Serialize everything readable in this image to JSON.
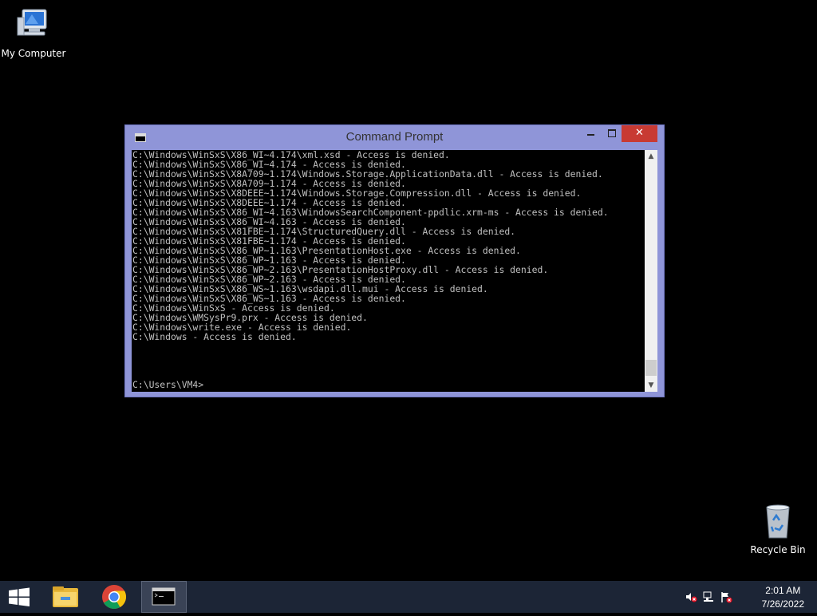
{
  "desktop": {
    "icons": [
      {
        "label": "My Computer"
      },
      {
        "label": "Recycle Bin"
      }
    ]
  },
  "window": {
    "title": "Command Prompt",
    "console_lines": [
      "C:\\Windows\\WinSxS\\X86_WI~4.174\\xml.xsd - Access is denied.",
      "C:\\Windows\\WinSxS\\X86_WI~4.174 - Access is denied.",
      "C:\\Windows\\WinSxS\\X8A709~1.174\\Windows.Storage.ApplicationData.dll - Access is denied.",
      "C:\\Windows\\WinSxS\\X8A709~1.174 - Access is denied.",
      "C:\\Windows\\WinSxS\\X8DEEE~1.174\\Windows.Storage.Compression.dll - Access is denied.",
      "C:\\Windows\\WinSxS\\X8DEEE~1.174 - Access is denied.",
      "C:\\Windows\\WinSxS\\X86_WI~4.163\\WindowsSearchComponent-ppdlic.xrm-ms - Access is denied.",
      "C:\\Windows\\WinSxS\\X86_WI~4.163 - Access is denied.",
      "C:\\Windows\\WinSxS\\X81FBE~1.174\\StructuredQuery.dll - Access is denied.",
      "C:\\Windows\\WinSxS\\X81FBE~1.174 - Access is denied.",
      "C:\\Windows\\WinSxS\\X86_WP~1.163\\PresentationHost.exe - Access is denied.",
      "C:\\Windows\\WinSxS\\X86_WP~1.163 - Access is denied.",
      "C:\\Windows\\WinSxS\\X86_WP~2.163\\PresentationHostProxy.dll - Access is denied.",
      "C:\\Windows\\WinSxS\\X86_WP~2.163 - Access is denied.",
      "C:\\Windows\\WinSxS\\X86_WS~1.163\\wsdapi.dll.mui - Access is denied.",
      "C:\\Windows\\WinSxS\\X86_WS~1.163 - Access is denied.",
      "C:\\Windows\\WinSxS - Access is denied.",
      "C:\\Windows\\WMSysPr9.prx - Access is denied.",
      "C:\\Windows\\write.exe - Access is denied.",
      "C:\\Windows - Access is denied."
    ],
    "prompt": "C:\\Users\\VM4>"
  },
  "taskbar": {
    "apps": [
      {
        "icon": "start-windows-icon"
      },
      {
        "icon": "file-explorer-icon"
      },
      {
        "icon": "chrome-icon"
      },
      {
        "icon": "command-prompt-icon"
      }
    ],
    "tray_icons": [
      "volume-muted-icon",
      "network-icon",
      "action-center-flag-icon"
    ],
    "clock": {
      "time": "2:01 AM",
      "date": "7/26/2022"
    }
  },
  "colors": {
    "window_frame": "#8f95d8",
    "close_button": "#c83a33",
    "taskbar": "#1c2536",
    "console_text": "#c0c0c0"
  }
}
